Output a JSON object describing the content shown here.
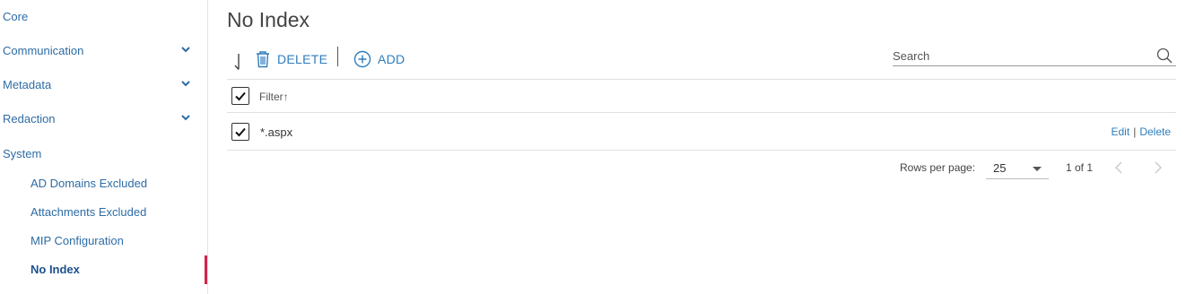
{
  "sidebar": {
    "items": [
      {
        "label": "Core"
      },
      {
        "label": "Communication"
      },
      {
        "label": "Metadata"
      },
      {
        "label": "Redaction"
      },
      {
        "label": "System"
      }
    ],
    "system_subitems": [
      {
        "label": "AD Domains Excluded"
      },
      {
        "label": "Attachments Excluded"
      },
      {
        "label": "MIP Configuration"
      },
      {
        "label": "No Index"
      }
    ],
    "active": "No Index",
    "active_color": "#d0234a"
  },
  "page": {
    "title": "No Index"
  },
  "toolbar": {
    "delete_label": "DELETE",
    "add_label": "ADD"
  },
  "search": {
    "placeholder": "Search"
  },
  "table": {
    "column_header": "Filter",
    "sort_indicator": "↑",
    "rows": [
      {
        "filter": "*.aspx",
        "edit_label": "Edit",
        "separator": "|",
        "delete_label": "Delete",
        "checked": true
      }
    ],
    "header_checked": true
  },
  "pagination": {
    "rows_per_page_label": "Rows per page:",
    "rows_per_page": "25",
    "page_info": "1 of 1"
  },
  "colors": {
    "accent": "#2e7dbd",
    "link": "#2e6ca5"
  }
}
